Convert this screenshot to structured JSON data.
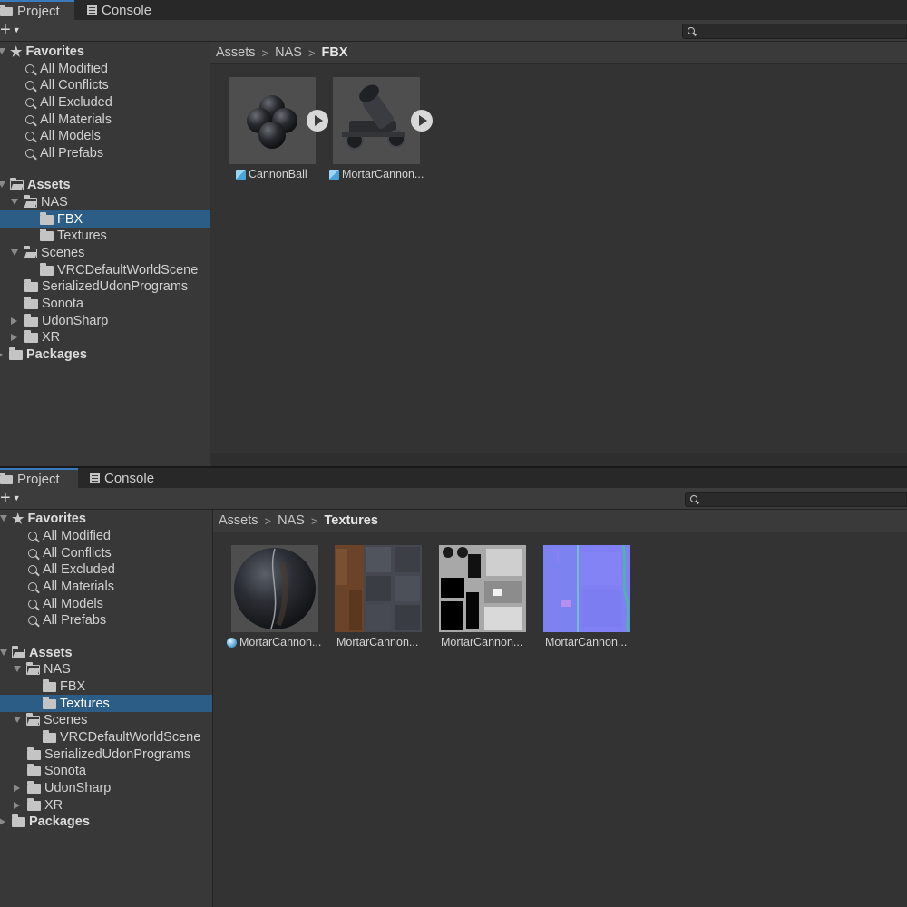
{
  "tabs": {
    "project": "Project",
    "console": "Console"
  },
  "toolbar": {
    "add_icon": "plus-icon",
    "search_placeholder": ""
  },
  "favorites": {
    "title": "Favorites",
    "items": [
      "All Modified",
      "All Conflicts",
      "All Excluded",
      "All Materials",
      "All Models",
      "All Prefabs"
    ]
  },
  "tree": {
    "assets": "Assets",
    "nas": "NAS",
    "fbx": "FBX",
    "textures": "Textures",
    "scenes": "Scenes",
    "vrc_scene": "VRCDefaultWorldScene",
    "serialized": "SerializedUdonPrograms",
    "sonota": "Sonota",
    "udonsharp": "UdonSharp",
    "xr": "XR",
    "packages": "Packages"
  },
  "panel_top": {
    "selected_folder": "FBX",
    "breadcrumb": [
      "Assets",
      "NAS",
      "FBX"
    ],
    "assets": [
      {
        "name": "CannonBall",
        "icon": "model-cube-icon"
      },
      {
        "name": "MortarCannon...",
        "icon": "model-cube-icon"
      }
    ]
  },
  "panel_bottom": {
    "selected_folder": "Textures",
    "breadcrumb": [
      "Assets",
      "NAS",
      "Textures"
    ],
    "assets": [
      {
        "name": "MortarCannon...",
        "icon": "material-sphere-icon"
      },
      {
        "name": "MortarCannon...",
        "icon": ""
      },
      {
        "name": "MortarCannon...",
        "icon": ""
      },
      {
        "name": "MortarCannon...",
        "icon": ""
      }
    ]
  },
  "colors": {
    "selection": "#2c5d87",
    "panel_bg": "#383838",
    "content_bg": "#333333",
    "accent_tab": "#3a79bb"
  }
}
